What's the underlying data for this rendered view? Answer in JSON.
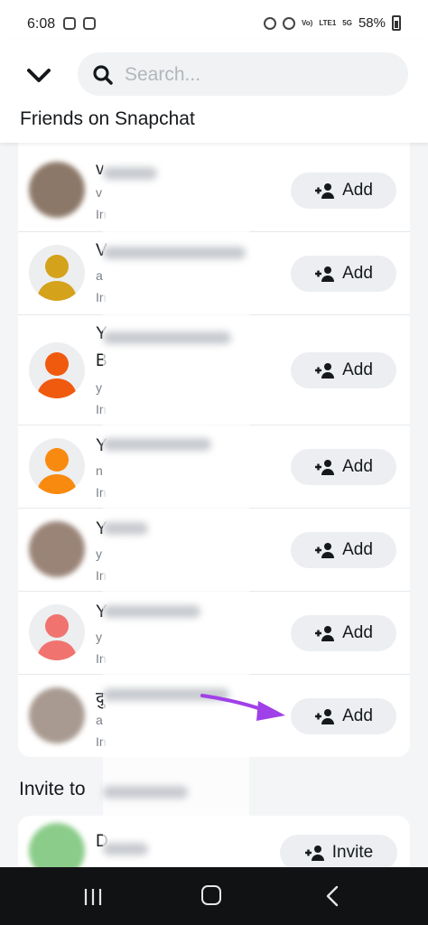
{
  "status_bar": {
    "time": "6:08",
    "battery": "58%",
    "signal_labels": [
      "Vo)",
      "LTE1",
      "5G"
    ]
  },
  "header": {
    "search_placeholder": "Search...",
    "section_title": "Friends on Snapchat"
  },
  "friends": [
    {
      "name": "v",
      "sub": "v",
      "sub2": "In",
      "avatar": "photo",
      "add_label": "Add"
    },
    {
      "name": "V",
      "sub": "a",
      "sub2": "In",
      "avatar": "yellow",
      "add_label": "Add"
    },
    {
      "name": "Y",
      "name2": "B",
      "sub": "y",
      "sub2": "In",
      "avatar": "orange-red",
      "add_label": "Add"
    },
    {
      "name": "Y",
      "sub": "n",
      "sub2": "In",
      "avatar": "orange",
      "add_label": "Add"
    },
    {
      "name": "Y",
      "sub": "y",
      "sub2": "In",
      "avatar": "photo",
      "add_label": "Add"
    },
    {
      "name": "Y",
      "sub": "y",
      "sub2": "In",
      "avatar": "salmon",
      "add_label": "Add"
    },
    {
      "name": "दु",
      "sub": "a",
      "sub2": "In",
      "avatar": "photo",
      "add_label": "Add"
    }
  ],
  "invite": {
    "title": "Invite to",
    "name": "D",
    "button_label": "Invite"
  },
  "colors": {
    "accent_arrow": "#a040e8",
    "avatar_yellow": "#d4a21b",
    "avatar_orange_red": "#f05a0e",
    "avatar_orange": "#f98a10",
    "avatar_salmon": "#f0736f"
  }
}
